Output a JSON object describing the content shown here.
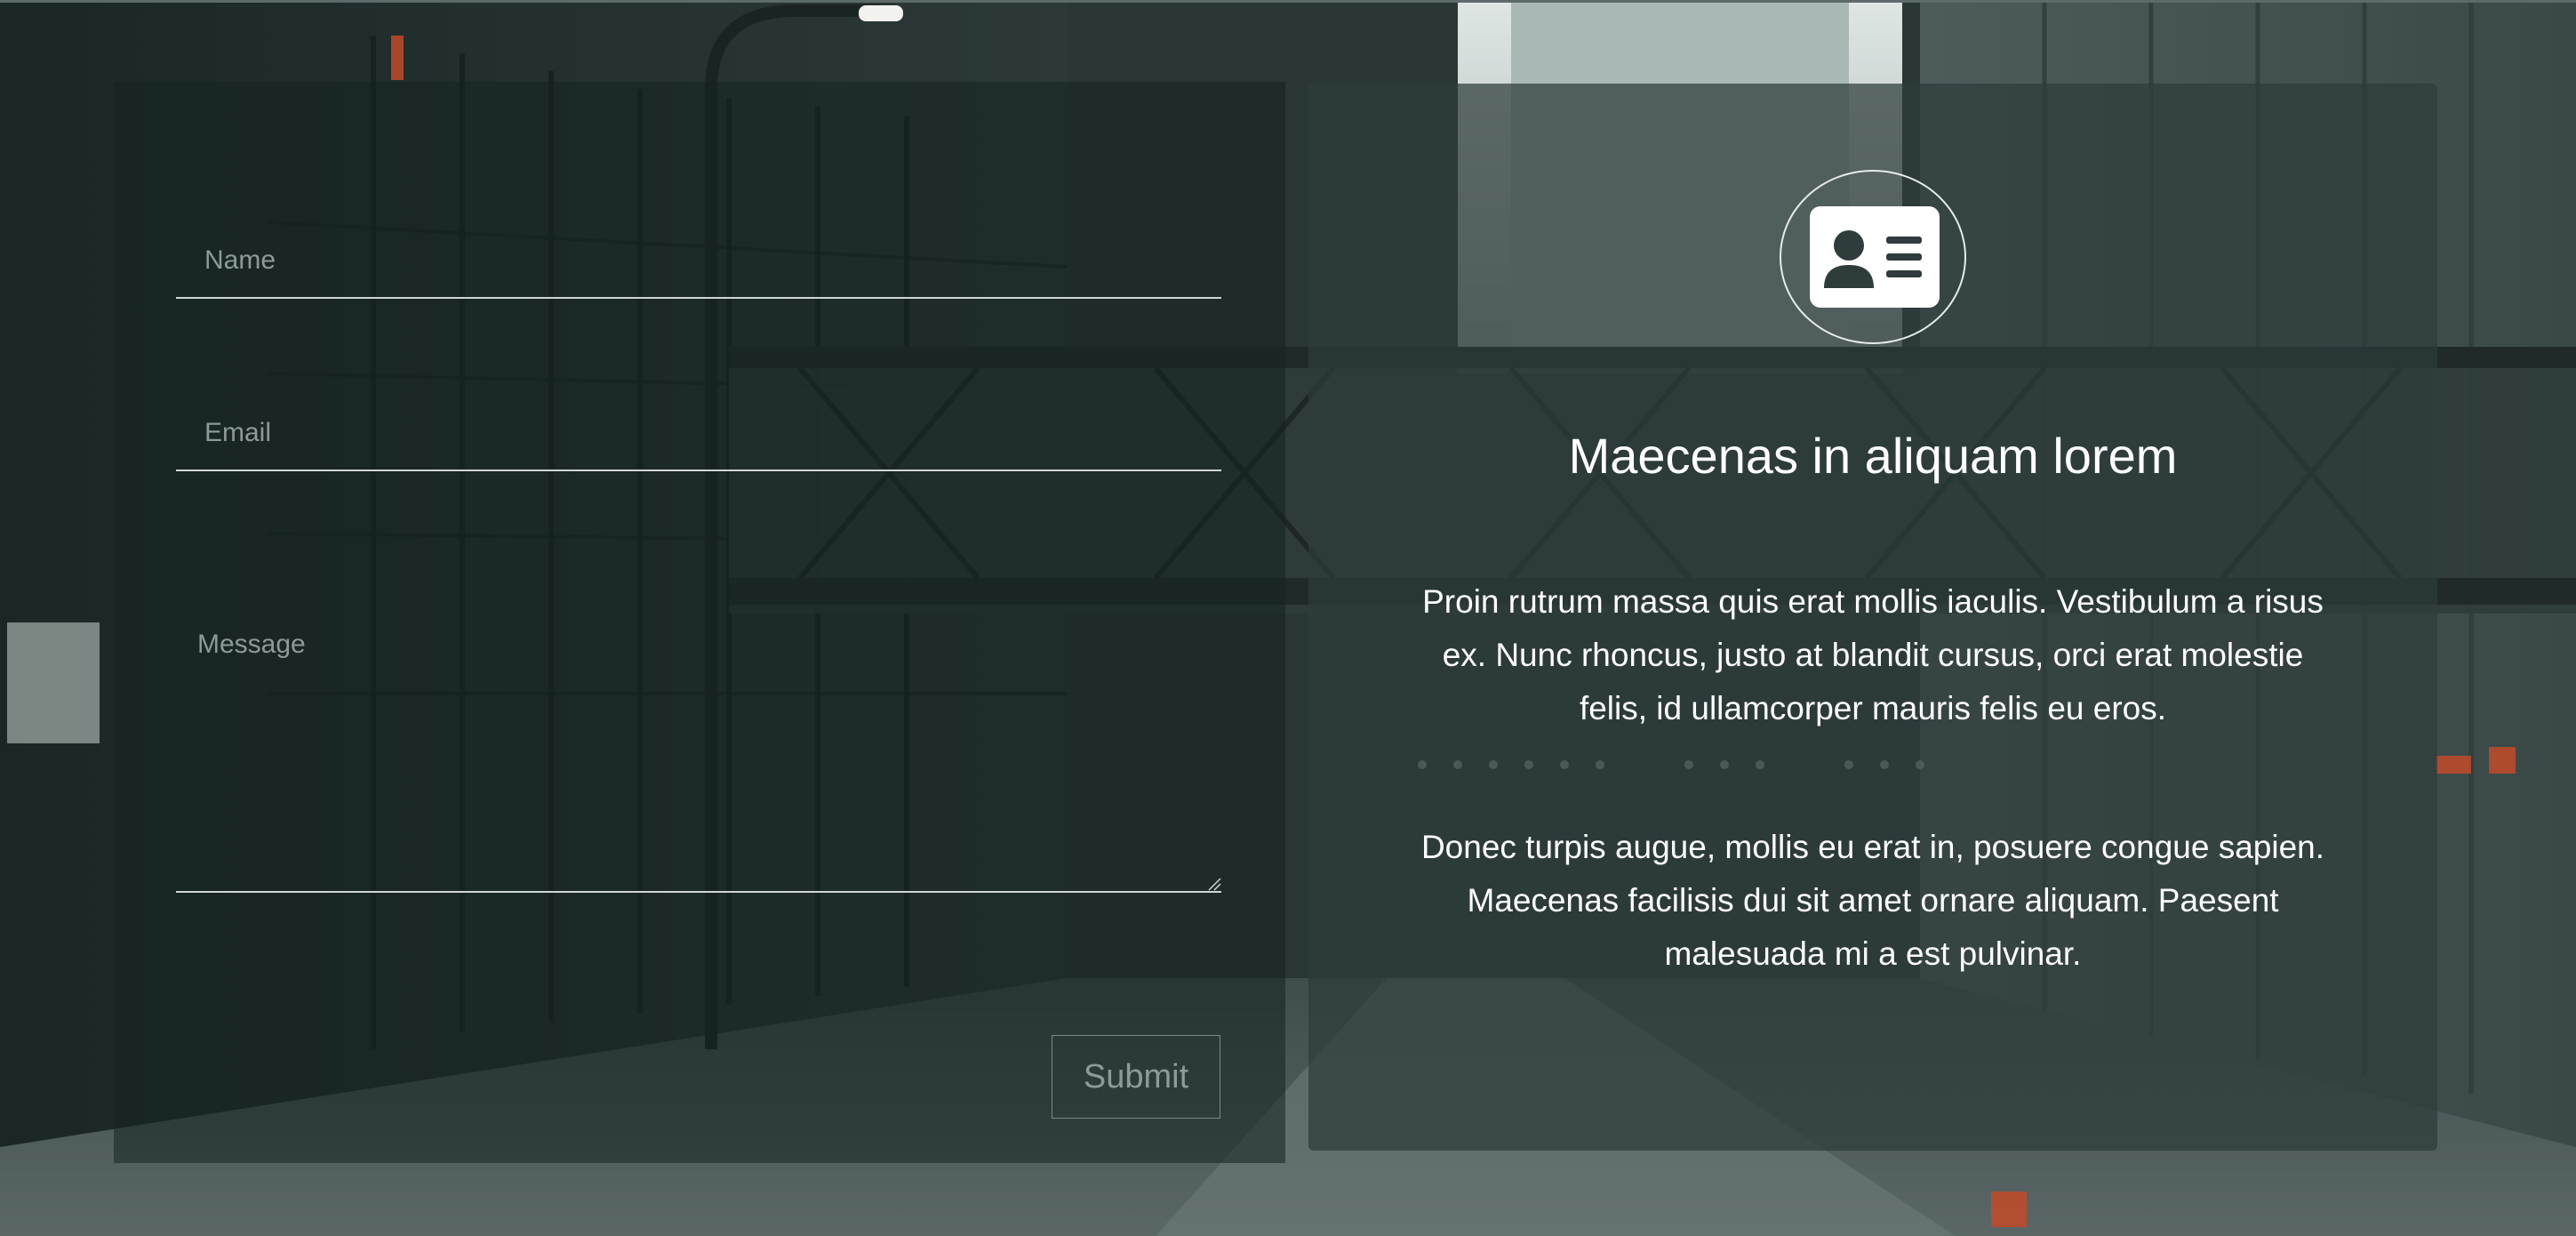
{
  "form": {
    "name_placeholder": "Name",
    "email_placeholder": "Email",
    "message_placeholder": "Message",
    "submit_label": "Submit"
  },
  "info": {
    "icon": "id-card-icon",
    "title": "Maecenas in aliquam lorem",
    "paragraph_1": "Proin rutrum massa quis erat mollis iaculis. Vestibulum a risus ex. Nunc rhoncus, justo at blandit cursus, orci erat molestie felis, id ullamcorper mauris felis eu eros.",
    "paragraph_2": "Donec turpis augue, mollis eu erat in, posuere congue sapien. Maecenas facilisis dui sit amet ornare aliquam. Paesent malesuada mi a est pulvinar."
  },
  "colors": {
    "panel_overlay": "#1a2a29",
    "text_primary": "#ffffff",
    "text_muted": "#8e9a9a",
    "line": "#cfd6d6"
  }
}
